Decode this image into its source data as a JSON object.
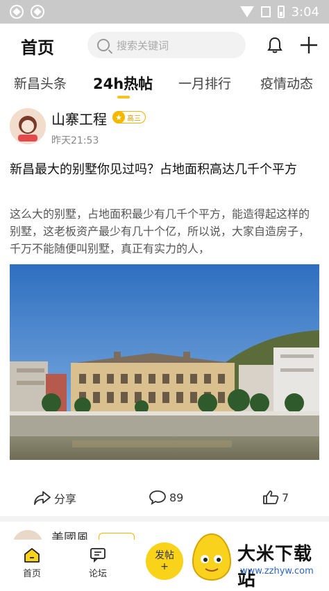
{
  "status_bar": {
    "time": "3:04"
  },
  "header": {
    "title": "首页",
    "search_placeholder": "搜索关键词"
  },
  "tabs": [
    {
      "label": "新昌头条"
    },
    {
      "label": "24h热帖",
      "active": true
    },
    {
      "label": "一月排行"
    },
    {
      "label": "疫情动态"
    }
  ],
  "post": {
    "author": "山寨工程",
    "level": "高三",
    "time": "昨天21:53",
    "title": "新昌最大的别墅你见过吗？占地面积高达几千个平方",
    "excerpt": "这么大的别墅，占地面积最少有几千个平方，能造得起这样的别墅，这老板资产最少有几十个亿，所以说，大家自造房子，千万不能随便叫别墅，真正有实力的人，",
    "share_label": "分享",
    "comments": "89",
    "likes": "7"
  },
  "next_post": {
    "author": "美國風"
  },
  "bottom_nav": {
    "home": "首页",
    "forum": "论坛",
    "post_line1": "发帖",
    "post_line2": "+"
  },
  "watermark": {
    "text": "大米下载站",
    "url": "www.zzhyw.com"
  },
  "colors": {
    "accent": "#f9d21a",
    "status_bar": "#c9c9c9"
  }
}
